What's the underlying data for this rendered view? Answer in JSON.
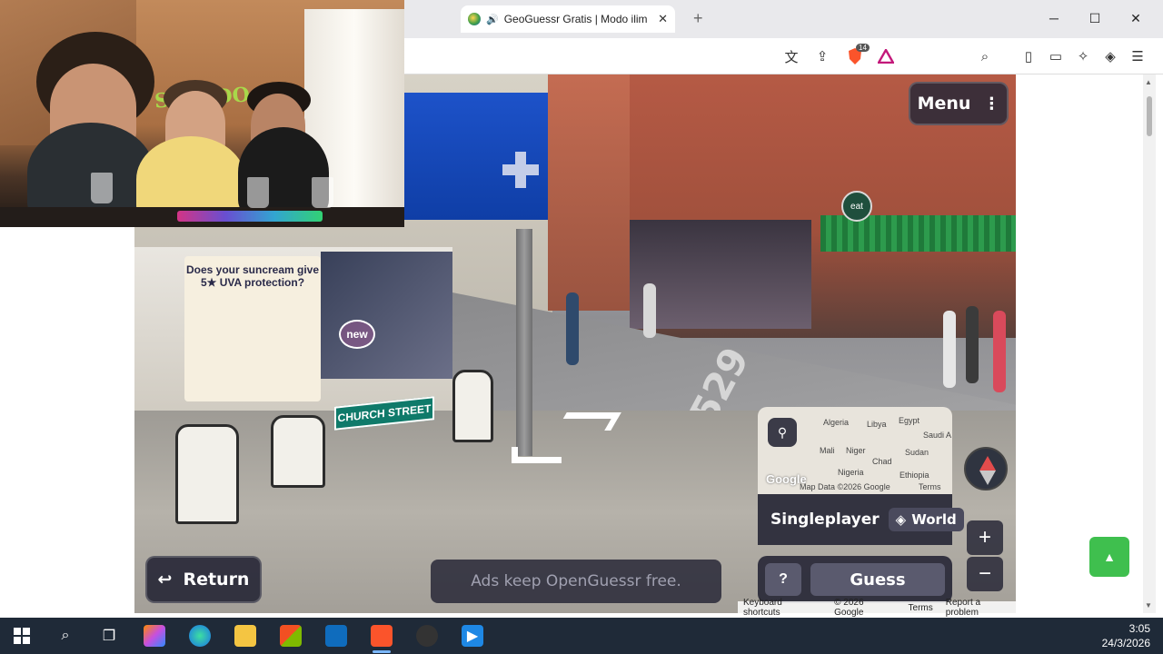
{
  "browser": {
    "tab_title": "GeoGuessr Gratis | Modo ilim",
    "tab_close": "✕",
    "new_tab": "+",
    "window_minimize": "─",
    "window_maximize": "☐",
    "window_close": "✕",
    "extension_badge": "14"
  },
  "streetview": {
    "poster_text": "Does your suncream give 5★ UVA protection?",
    "window_badge": "new",
    "street_sign": "CHURCH STREET",
    "road_marking": "B1529",
    "shop_sign": "eat"
  },
  "game": {
    "menu_label": "Menu",
    "menu_dots": "⋮",
    "mode_label": "Singleplayer",
    "map_name": "World",
    "return_label": "Return",
    "return_icon": "↩",
    "ad_text": "Ads keep OpenGuessr free.",
    "guess_hint": "?",
    "guess_label": "Guess",
    "zoom_in": "+",
    "zoom_out": "−"
  },
  "minimap": {
    "labels": [
      "Algeria",
      "Libya",
      "Egypt",
      "Saudi A",
      "Mali",
      "Niger",
      "Sudan",
      "Chad",
      "Nigeria",
      "Ethiopia"
    ],
    "google": "Google",
    "attribution": "Map Data ©2026 Google",
    "terms": "Terms"
  },
  "footer": {
    "shortcuts": "Keyboard shortcuts",
    "copyright": "© 2026 Google",
    "terms": "Terms",
    "report": "Report a problem"
  },
  "taskbar": {
    "time": "3:05",
    "date": "24/3/2026"
  },
  "colors": {
    "accent_green": "#3fbf4e",
    "panel_dark": "#282837",
    "taskbar": "#1f2a38"
  }
}
